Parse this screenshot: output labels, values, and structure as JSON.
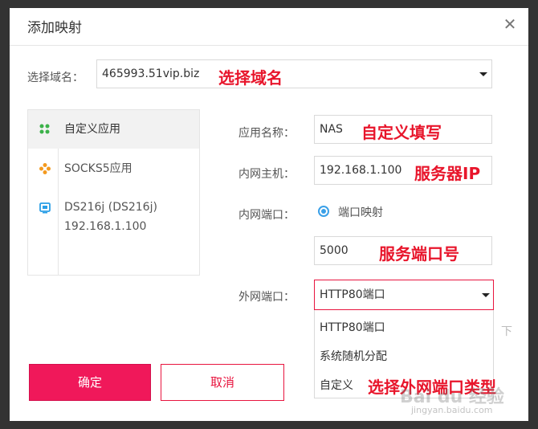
{
  "dialog": {
    "title": "添加映射",
    "close_glyph": "✕"
  },
  "domain": {
    "label": "选择域名：",
    "value": "465993.51vip.biz",
    "annotation": "选择域名"
  },
  "apps": [
    {
      "label": "自定义应用",
      "icon": "custom-app-icon",
      "active": true
    },
    {
      "label": "SOCKS5应用",
      "icon": "socks5-icon",
      "active": false
    },
    {
      "label": "DS216j (DS216j)",
      "sub": "192.168.1.100",
      "icon": "nas-device-icon",
      "active": false
    }
  ],
  "form": {
    "app_name_label": "应用名称：",
    "app_name_value": "NAS",
    "app_name_annotation": "自定义填写",
    "host_label": "内网主机：",
    "host_value": "192.168.1.100",
    "host_annotation": "服务器IP",
    "port_label": "内网端口：",
    "port_radio_label": "端口映射",
    "port_value": "5000",
    "port_annotation": "服务端口号",
    "ext_port_label": "外网端口：",
    "ext_port_value": "HTTP80端口",
    "ext_port_options": [
      "HTTP80端口",
      "系统随机分配",
      "自定义"
    ],
    "ext_port_annotation": "选择外网端口类型"
  },
  "buttons": {
    "ok": "确定",
    "cancel": "取消"
  },
  "watermark": {
    "brand": "Bai du 经验",
    "url": "jingyan.baidu.com"
  },
  "colors": {
    "accent": "#f0185a",
    "annotation": "#e8152b",
    "radio": "#3aa0e8"
  }
}
